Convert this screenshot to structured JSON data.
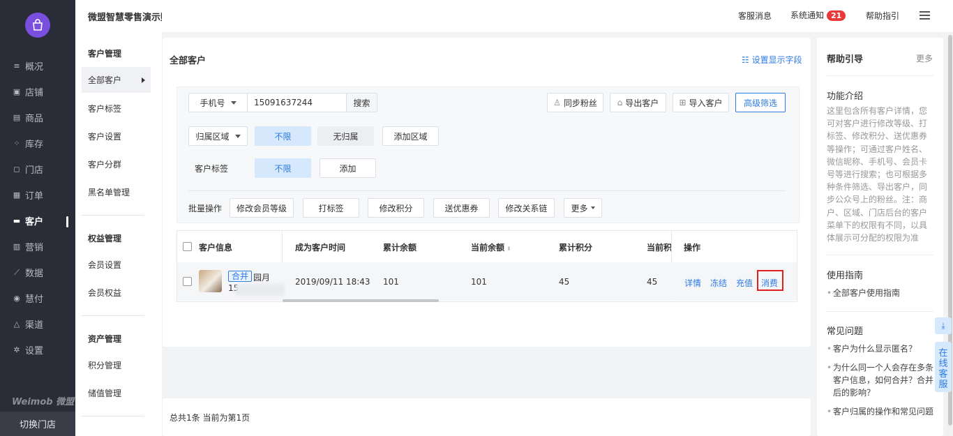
{
  "app": {
    "title": "微盟智慧零售演示账号"
  },
  "leftnav": {
    "items": [
      {
        "label": "概况",
        "icon": "≡"
      },
      {
        "label": "店铺",
        "icon": "▣"
      },
      {
        "label": "商品",
        "icon": "▤"
      },
      {
        "label": "库存",
        "icon": "⁘"
      },
      {
        "label": "门店",
        "icon": "◻"
      },
      {
        "label": "订单",
        "icon": "▦"
      },
      {
        "label": "客户",
        "icon": "▬"
      },
      {
        "label": "营销",
        "icon": "▥"
      },
      {
        "label": "数据",
        "icon": "⟋"
      },
      {
        "label": "慧付",
        "icon": "◉"
      },
      {
        "label": "渠道",
        "icon": "△"
      },
      {
        "label": "设置",
        "icon": "✲"
      }
    ],
    "brand": "Weimob 微盟",
    "switch_store": "切换门店"
  },
  "subnav": {
    "groups": [
      {
        "title": "客户管理",
        "items": [
          "全部客户",
          "客户标签",
          "客户设置",
          "客户分群",
          "黑名单管理"
        ]
      },
      {
        "title": "权益管理",
        "items": [
          "会员设置",
          "会员权益"
        ]
      },
      {
        "title": "资产管理",
        "items": [
          "积分管理",
          "储值管理"
        ]
      }
    ]
  },
  "topbar": {
    "service": "客服消息",
    "notice": "系统通知",
    "notice_count": "21",
    "help": "帮助指引"
  },
  "main": {
    "title": "全部客户",
    "set_fields": "设置显示字段",
    "search_type": "手机号",
    "search_value": "15091637244",
    "search_btn": "搜索",
    "sync_fans": "同步粉丝",
    "export": "导出客户",
    "import": "导入客户",
    "advanced": "高级筛选",
    "region_select": "归属区域",
    "region_all": "不限",
    "region_none": "无归属",
    "region_add": "添加区域",
    "tag_label": "客户标签",
    "tag_all": "不限",
    "tag_add": "添加",
    "batch_label": "批量操作",
    "batch": [
      "修改会员等级",
      "打标签",
      "修改积分",
      "送优惠券",
      "修改关系链"
    ],
    "batch_more": "更多"
  },
  "table": {
    "headers": [
      "客户信息",
      "成为客户时间",
      "累计余额",
      "当前余额",
      "累计积分",
      "当前积",
      "操作"
    ],
    "row": {
      "tag": "合并",
      "name": "园月",
      "phone_prefix": "15",
      "time": "2019/09/11 18:43",
      "total_balance": "101",
      "current_balance": "101",
      "total_points": "45",
      "current_points": "45",
      "ops": [
        "详情",
        "冻结",
        "充值",
        "消费"
      ]
    }
  },
  "footer": {
    "text": "总共1条 当前为第1页"
  },
  "help": {
    "title": "帮助引导",
    "more": "更多",
    "intro_title": "功能介绍",
    "intro_text": "这里包含所有客户详情，您可对客户进行修改等级、打标签、修改积分、送优惠券等操作；可通过客户姓名、微信昵称、手机号、会员卡号等进行搜索；也可根据多种条件筛选、导出客户，同步公众号上的粉丝。注：商户、区域、门店后台的客户菜单下的权限有不同，以具体展示可分配的权限为准",
    "guide_title": "使用指南",
    "guide_link": "全部客户使用指南",
    "faq_title": "常见问题",
    "faq": [
      "客户为什么显示匿名？",
      "为什么同一个人会存在多条客户信息，如何合并？合并后的影响？",
      "客户归属的操作和常见问题"
    ]
  },
  "float": {
    "download_icon": "⤓",
    "online_service": "在线客服"
  },
  "colors": {
    "primary": "#2d7be5",
    "nav_bg": "#2a2d38",
    "brand": "#7a4fe0",
    "badge": "#e8393a",
    "highlight": "#e02020"
  }
}
